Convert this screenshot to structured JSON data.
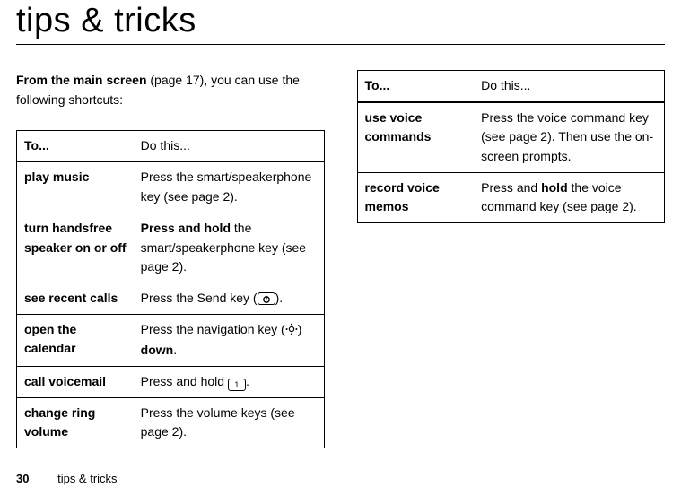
{
  "title": "tips & tricks",
  "intro": {
    "bold": "From the main screen",
    "rest": " (page 17), you can use the following shortcuts:"
  },
  "tableHeaders": {
    "to": "To...",
    "do": "Do this..."
  },
  "left": [
    {
      "to": "play music",
      "do": "Press the smart/speakerphone key (see page 2)."
    },
    {
      "to": "turn handsfree speaker on or off",
      "do": "<b>Press and hold</b> the smart/speakerphone key (see page 2)."
    },
    {
      "to": "see recent calls",
      "do": "Press the Send key ({SEND})."
    },
    {
      "to": "open the calendar",
      "do": "Press the navigation key ({NAV}) <b>down</b>."
    },
    {
      "to": "call voicemail",
      "do": "Press and hold {ONE}."
    },
    {
      "to": "change ring volume",
      "do": "Press the volume keys (see page 2)."
    }
  ],
  "right": [
    {
      "to": "use voice commands",
      "do": "Press the voice command key (see page 2). Then use the on-screen prompts."
    },
    {
      "to": "record voice memos",
      "do": "Press and <b>hold</b> the voice command key (see page 2)."
    }
  ],
  "footer": {
    "page": "30",
    "section": "tips & tricks"
  },
  "icons": {
    "send": "⏻",
    "one": "1"
  }
}
